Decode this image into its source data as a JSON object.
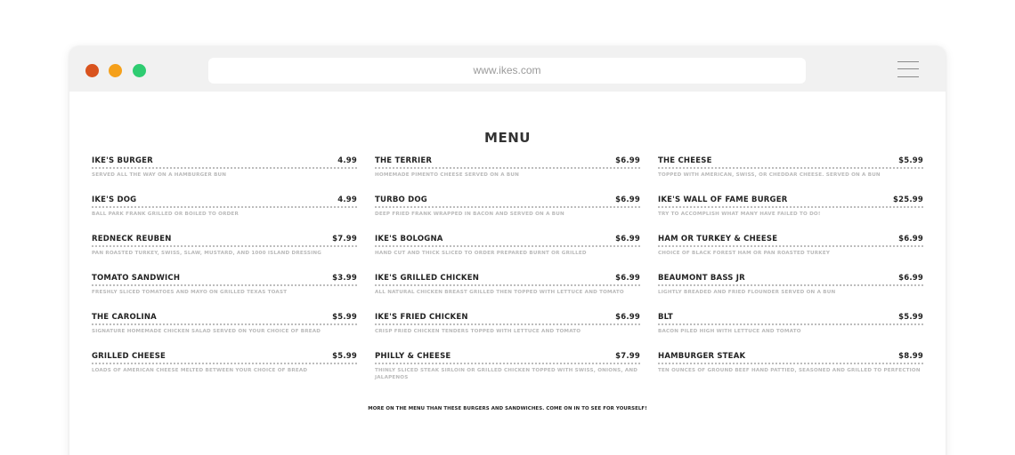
{
  "colors": {
    "close_dot": "#d9531e",
    "minimize_dot": "#f5a01a",
    "maximize_dot": "#2ecc71",
    "titlebar": "#f1f1f1"
  },
  "browser": {
    "url": "www.ikes.com",
    "menu_icon": "hamburger-menu-icon"
  },
  "menu": {
    "title": "MENU",
    "footer": "MORE ON THE MENU THAN THESE BURGERS AND SANDWICHES. COME ON IN TO SEE FOR YOURSELF!",
    "columns": [
      [
        {
          "name": "IKE'S BURGER",
          "price": "4.99",
          "desc": "SERVED ALL THE WAY ON A HAMBURGER BUN"
        },
        {
          "name": "IKE'S DOG",
          "price": "4.99",
          "desc": "BALL PARK FRANK GRILLED OR BOILED TO ORDER"
        },
        {
          "name": "REDNECK REUBEN",
          "price": "$7.99",
          "desc": "PAN ROASTED TURKEY, SWISS, SLAW, MUSTARD, AND 1000 ISLAND DRESSING"
        },
        {
          "name": "TOMATO SANDWICH",
          "price": "$3.99",
          "desc": "FRESHLY SLICED TOMATOES AND MAYO ON GRILLED TEXAS TOAST"
        },
        {
          "name": "THE CAROLINA",
          "price": "$5.99",
          "desc": "SIGNATURE HOMEMADE CHICKEN SALAD SERVED ON YOUR CHOICE OF BREAD"
        },
        {
          "name": "GRILLED CHEESE",
          "price": "$5.99",
          "desc": "LOADS OF AMERICAN CHEESE MELTED BETWEEN YOUR CHOICE OF BREAD"
        }
      ],
      [
        {
          "name": "THE TERRIER",
          "price": "$6.99",
          "desc": "HOMEMADE PIMENTO CHEESE SERVED ON A BUN"
        },
        {
          "name": "TURBO DOG",
          "price": "$6.99",
          "desc": "DEEP FRIED FRANK WRAPPED IN BACON AND SERVED ON A BUN"
        },
        {
          "name": "IKE'S BOLOGNA",
          "price": "$6.99",
          "desc": "HAND CUT AND THICK SLICED TO ORDER PREPARED BURNT OR GRILLED"
        },
        {
          "name": "IKE'S GRILLED CHICKEN",
          "price": "$6.99",
          "desc": "ALL NATURAL CHICKEN BREAST GRILLED THEN TOPPED WITH LETTUCE AND TOMATO"
        },
        {
          "name": "IKE'S FRIED CHICKEN",
          "price": "$6.99",
          "desc": "CRISP FRIED CHICKEN TENDERS TOPPED WITH LETTUCE AND TOMATO"
        },
        {
          "name": "PHILLY & CHEESE",
          "price": "$7.99",
          "desc": "THINLY SLICED STEAK SIRLOIN OR GRILLED CHICKEN TOPPED WITH SWISS, ONIONS, AND JALAPENOS"
        }
      ],
      [
        {
          "name": "THE CHEESE",
          "price": "$5.99",
          "desc": "TOPPED WITH AMERICAN, SWISS, OR CHEDDAR CHEESE. SERVED ON A BUN"
        },
        {
          "name": "IKE'S WALL OF FAME BURGER",
          "price": "$25.99",
          "desc": "TRY TO ACCOMPLISH WHAT MANY HAVE FAILED TO DO!"
        },
        {
          "name": "HAM OR TURKEY & CHEESE",
          "price": "$6.99",
          "desc": "CHOICE OF BLACK FOREST HAM OR PAN ROASTED TURKEY"
        },
        {
          "name": "BEAUMONT BASS JR",
          "price": "$6.99",
          "desc": "LIGHTLY BREADED AND FRIED FLOUNDER SERVED ON A BUN"
        },
        {
          "name": "BLT",
          "price": "$5.99",
          "desc": "BACON PILED HIGH WITH LETTUCE AND TOMATO"
        },
        {
          "name": "HAMBURGER STEAK",
          "price": "$8.99",
          "desc": "TEN OUNCES OF GROUND BEEF HAND PATTIED, SEASONED AND GRILLED TO PERFECTION"
        }
      ]
    ]
  }
}
